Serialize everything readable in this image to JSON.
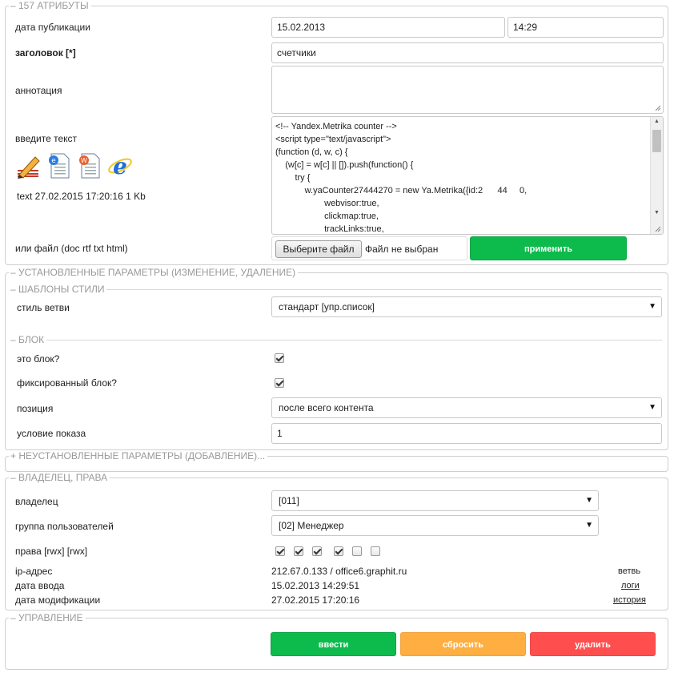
{
  "attributes": {
    "legend": "– 157 АТРИБУТЫ",
    "pub_date_label": "дата публикации",
    "pub_date": "15.02.2013",
    "pub_time": "14:29",
    "title_label": "заголовок  [*]",
    "title_value": "счетчики",
    "annotation_label": "аннотация",
    "annotation_value": "",
    "text_label": "введите текст",
    "text_info": "text  27.02.2015 17:20:16  1 Kb",
    "code_lines": [
      "<!-- Yandex.Metrika counter -->",
      "<script type=\"text/javascript\">",
      "(function (d, w, c) {",
      "    (w[c] = w[c] || []).push(function() {",
      "        try {",
      "            w.yaCounter27444270 = new Ya.Metrika({id:2      44     0,",
      "                    webvisor:true,",
      "                    clickmap:true,",
      "                    trackLinks:true,"
    ],
    "file_label": "или файл (doc rtf txt html)",
    "file_button": "Выберите файл",
    "file_status": "Файл не выбран",
    "apply_button": "применить"
  },
  "installed": {
    "legend": "– УСТАНОВЛЕННЫЕ ПАРАМЕТРЫ (ИЗМЕНЕНИЕ, УДАЛЕНИЕ)",
    "templates_legend": "– ШАБЛОНЫ СТИЛИ",
    "branch_style_label": "стиль ветви",
    "branch_style_value": "стандарт [упр.список]",
    "block_legend": "– БЛОК",
    "is_block_label": "это блок?",
    "is_block": true,
    "fixed_block_label": "фиксированный блок?",
    "fixed_block": true,
    "position_label": "позиция",
    "position_value": "после всего контента",
    "condition_label": "условие показа",
    "condition_value": "1"
  },
  "uninstalled": {
    "legend": "+ НЕУСТАНОВЛЕННЫЕ ПАРАМЕТРЫ (ДОБАВЛЕНИЕ)..."
  },
  "owner": {
    "legend": "– ВЛАДЕЛЕЦ, ПРАВА",
    "owner_label": "владелец",
    "owner_value": "[011]",
    "group_label": "группа пользователей",
    "group_value": "[02] Менеджер",
    "rights_label": "права [rwx] [rwx]",
    "rights": [
      true,
      true,
      true,
      true,
      false,
      false
    ],
    "ip_label": "ip-адрес",
    "ip_value": "212.67.0.133 / office6.graphit.ru",
    "entry_date_label": "дата ввода",
    "entry_date_value": "15.02.2013 14:29:51",
    "mod_date_label": "дата модификации",
    "mod_date_value": "27.02.2015 17:20:16",
    "branch_link": "ветвь",
    "logs_link": "логи",
    "history_link": "история"
  },
  "control": {
    "legend": "– УПРАВЛЕНИЕ",
    "submit_button": "ввести",
    "reset_button": "сбросить",
    "delete_button": "удалить"
  },
  "colors": {
    "green": "#0dbb4d",
    "orange": "#ffae42",
    "red": "#ff4e4e"
  }
}
